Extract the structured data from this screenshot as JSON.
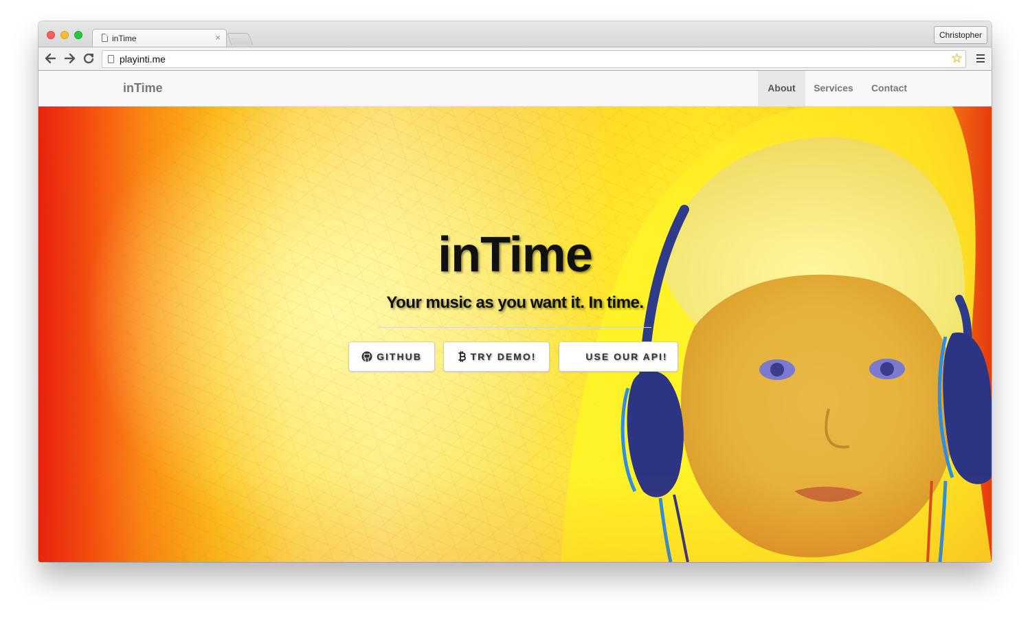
{
  "browser": {
    "tab_title": "inTime",
    "tab_close_glyph": "×",
    "profile_name": "Christopher",
    "url": "playinti.me",
    "icons": {
      "back": "arrow-left-icon",
      "forward": "arrow-right-icon",
      "reload": "reload-icon",
      "bookmark": "star-icon",
      "menu": "hamburger-menu-icon"
    },
    "star_color": "#f1c40f"
  },
  "site": {
    "brand": "inTime",
    "nav": [
      {
        "label": "About",
        "active": true
      },
      {
        "label": "Services",
        "active": false
      },
      {
        "label": "Contact",
        "active": false
      }
    ]
  },
  "hero": {
    "title": "inTime",
    "subtitle": "Your music as you want it. In time.",
    "buttons": [
      {
        "label": "GITHUB",
        "icon": "github-icon"
      },
      {
        "label": "TRY DEMO!",
        "icon": "bitcoin-icon"
      },
      {
        "label": "USE OUR API!",
        "icon": null
      }
    ],
    "colors": {
      "left": "#e8200f",
      "center": "#fdeb7a",
      "right": "#fff02a"
    }
  }
}
